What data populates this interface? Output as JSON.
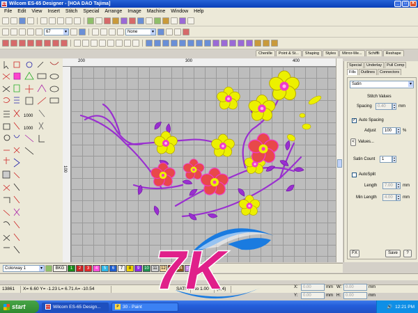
{
  "window": {
    "title": "Wilcom ES-65 Designer - [HOA DAO     Tajima]",
    "icon_label": "ES",
    "buttons": [
      "_",
      "□",
      "✕"
    ]
  },
  "menu": [
    "File",
    "Edit",
    "View",
    "Insert",
    "Stitch",
    "Special",
    "Arrange",
    "Image",
    "Machine",
    "Window",
    "Help"
  ],
  "toolbar": {
    "zoom_value": "67",
    "none_value": "None"
  },
  "object_tabs": [
    "Chenille",
    "Point & St...",
    "Shaping",
    "Styles",
    "Mirror-Me...",
    "Schiffli",
    "Reshape"
  ],
  "ruler": {
    "h_labels": [
      "200",
      "300",
      "400"
    ],
    "v_labels": [
      "100"
    ]
  },
  "properties": {
    "tabs_row1": [
      "Special",
      "Underlay",
      "Pull Comp"
    ],
    "tabs_row2": [
      "Fills",
      "Outlines",
      "Connectors"
    ],
    "fill_type": "Satin",
    "stitch_values_label": "Stitch Values",
    "spacing_label": "Spacing",
    "spacing_value": "0.40",
    "spacing_unit": "mm",
    "auto_spacing_label": "Auto Spacing",
    "adjust_label": "Adjust",
    "adjust_value": "100",
    "adjust_unit": "%",
    "values_button": "Values...",
    "satin_count_label": "Satin Count",
    "satin_count_value": "1",
    "autosplit_label": "AutoSplit",
    "length_label": "Length",
    "length_value": "7.00",
    "length_unit": "mm",
    "min_length_label": "Min Length",
    "min_length_value": "4.00",
    "min_length_unit": "mm",
    "fx_button": "FX",
    "save_button": "Save",
    "help_button": "?"
  },
  "colorbar": {
    "colorway_value": "Colorway 1",
    "bkg_label": "BKG",
    "swatches": [
      {
        "n": "1",
        "c": "#1a8a1a"
      },
      {
        "n": "2",
        "c": "#cc2222"
      },
      {
        "n": "3",
        "c": "#e02a2a"
      },
      {
        "n": "4",
        "c": "#ff4fd8"
      },
      {
        "n": "5",
        "c": "#2fb8e8"
      },
      {
        "n": "6",
        "c": "#1f5fd0"
      },
      {
        "n": "7",
        "c": "#f2f2f2"
      },
      {
        "n": "8",
        "c": "#f2d600"
      },
      {
        "n": "9",
        "c": "#8a2be2"
      },
      {
        "n": "10",
        "c": "#1f8f4f"
      },
      {
        "n": "11",
        "c": "#d4d4d4"
      },
      {
        "n": "12",
        "c": "#f5d8a0"
      },
      {
        "n": "13",
        "c": "#b00000"
      },
      {
        "n": "14",
        "c": "#8a5a1a"
      },
      {
        "n": "15",
        "c": "#c080e0"
      }
    ]
  },
  "status": {
    "stitch_count": "13861",
    "coords": "X= 6.60 Y= -1.23 L= 6.71 A= -10.54",
    "mode": "SATIN",
    "no_label": "No 1.00",
    "extra": "(1,4)"
  },
  "coord_panel": {
    "x_label": "X:",
    "x_value": "0.00",
    "x_unit": "mm",
    "w_label": "W:",
    "w_value": "0.00",
    "w_unit": "mm",
    "y_label": "Y:",
    "y_value": "0.00",
    "y_unit": "mm",
    "h_label": "H:",
    "h_value": "0.00",
    "h_unit": "mm"
  },
  "taskbar": {
    "start_label": "start",
    "tasks": [
      {
        "label": "Wilcom ES-65 Design...",
        "icon": "ES"
      },
      {
        "label": "30 - Paint",
        "icon": "P"
      }
    ],
    "clock": "12:21 PM"
  },
  "colors": {
    "petal_yellow": "#ecf000",
    "petal_red": "#e8484a",
    "center_pink": "#f03cc8",
    "stem_purple": "#9a2fd0",
    "logo_pink": "#e0208a",
    "logo_blue": "#1a7be0"
  },
  "logo": {
    "text": "7K",
    "icon": "7k-watermark-logo"
  }
}
